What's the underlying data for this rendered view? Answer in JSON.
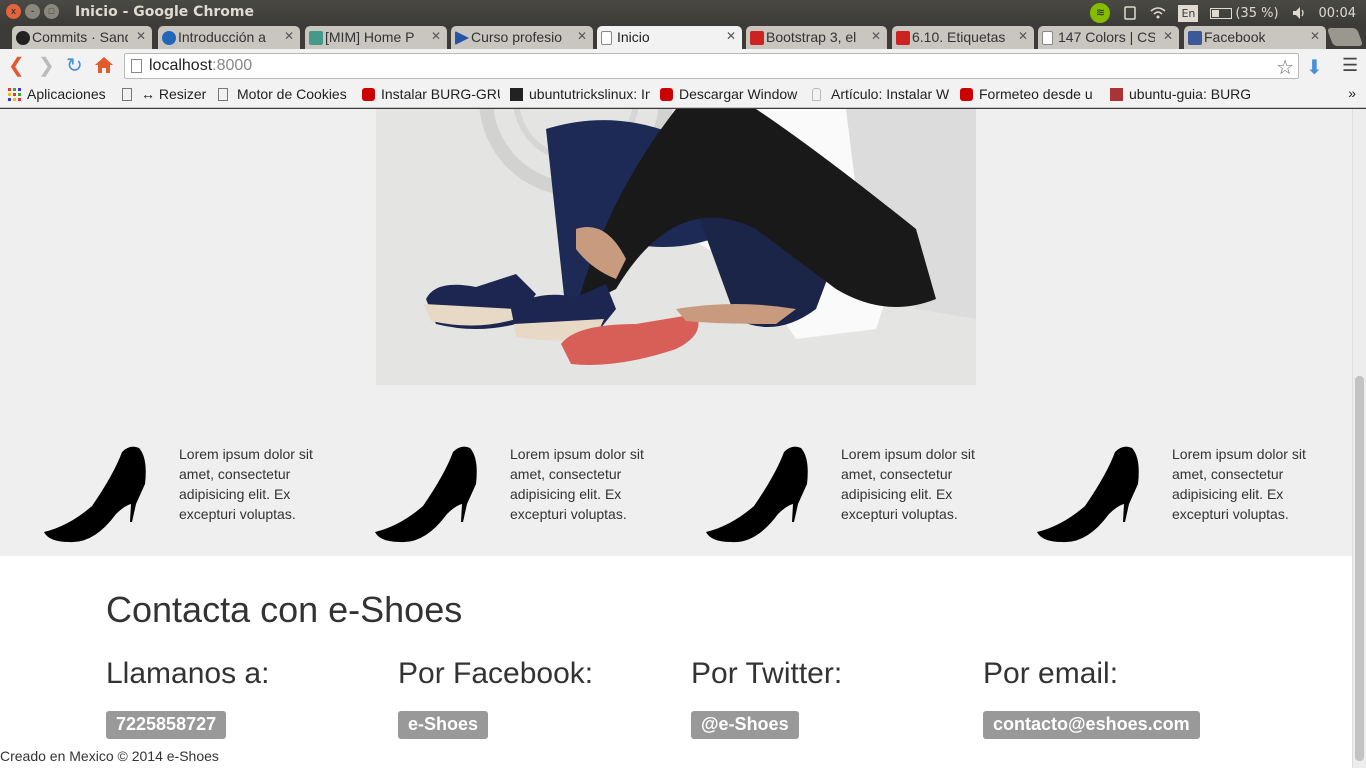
{
  "window": {
    "title": "Inicio - Google Chrome",
    "controls": [
      "x",
      "-",
      "□"
    ]
  },
  "tray": {
    "language": "En",
    "battery": "(35 %)",
    "time": "00:04"
  },
  "tabs": [
    {
      "label": "Commits · Sand",
      "favicon": "github-icon",
      "color": "#222222"
    },
    {
      "label": "Introducción a",
      "favicon": "globe-icon",
      "color": "#2266bb"
    },
    {
      "label": "[MIM] Home P",
      "favicon": "mim-icon",
      "color": "#449988"
    },
    {
      "label": "Curso profesio",
      "favicon": "play-icon",
      "color": "#2255aa"
    },
    {
      "label": "Inicio",
      "favicon": "page-icon",
      "color": "#ffffff",
      "active": true
    },
    {
      "label": "Bootstrap 3, el",
      "favicon": "book-icon",
      "color": "#cc2222"
    },
    {
      "label": "6.10. Etiquetas",
      "favicon": "book-icon",
      "color": "#cc2222"
    },
    {
      "label": "147 Colors | CS",
      "favicon": "page-icon",
      "color": "#ffffff"
    },
    {
      "label": "Facebook",
      "favicon": "facebook-icon",
      "color": "#3b5998"
    }
  ],
  "toolbar": {
    "url_host": "localhost",
    "url_rest": ":8000"
  },
  "bookmarks": [
    {
      "label": "Aplicaciones",
      "icon": "apps-icon"
    },
    {
      "label": "↔ Resizer",
      "icon": "page-icon"
    },
    {
      "label": "Motor de Cookies",
      "icon": "page-icon"
    },
    {
      "label": "Instalar BURG-GRU",
      "icon": "youtube-icon"
    },
    {
      "label": "ubuntutrickslinux: In",
      "icon": "blogger-icon"
    },
    {
      "label": "Descargar Window",
      "icon": "youtube-icon"
    },
    {
      "label": "Artículo: Instalar W",
      "icon": "bottle-icon"
    },
    {
      "label": "Formeteo desde u",
      "icon": "youtube-icon"
    },
    {
      "label": "ubuntu-guia: BURG",
      "icon": "ubuntu-guia-icon"
    }
  ],
  "bookmarks_more": "»",
  "page": {
    "features": [
      {
        "text": "Lorem ipsum dolor sit amet, consectetur adipisicing elit. Ex excepturi voluptas."
      },
      {
        "text": "Lorem ipsum dolor sit amet, consectetur adipisicing elit. Ex excepturi voluptas."
      },
      {
        "text": "Lorem ipsum dolor sit amet, consectetur adipisicing elit. Ex excepturi voluptas."
      },
      {
        "text": "Lorem ipsum dolor sit amet, consectetur adipisicing elit. Ex excepturi voluptas."
      }
    ],
    "contact": {
      "title": "Contacta con e-Shoes",
      "columns": [
        {
          "heading": "Llamanos a:",
          "value": "7225858727"
        },
        {
          "heading": "Por Facebook:",
          "value": "e-Shoes"
        },
        {
          "heading": "Por Twitter:",
          "value": "@e-Shoes"
        },
        {
          "heading": "Por email:",
          "value": "contacto@eshoes.com"
        }
      ]
    },
    "footer": "Creado en Mexico © 2014 e-Shoes"
  }
}
